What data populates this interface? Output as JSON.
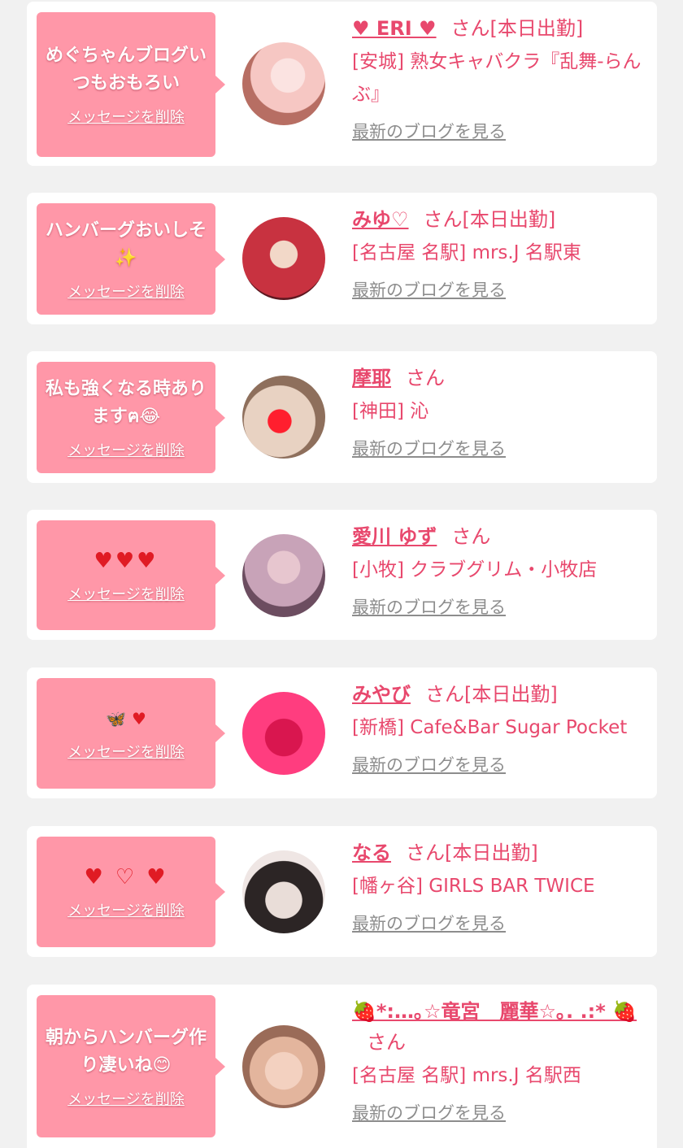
{
  "entries": [
    {
      "message": "めぐちゃんブログいつもおもろい",
      "delete_label": "メッセージを削除",
      "name": "♥ ERI ♥",
      "suffix": "さん[本日出勤]",
      "shop": "[安城] 熟女キャバクラ『乱舞-らんぶ』",
      "blog_link": "最新のブログを見る",
      "avatar_colors": [
        "#f6c7c3",
        "#b76e63"
      ]
    },
    {
      "message": "ハンバーグおいしそ✨",
      "delete_label": "メッセージを削除",
      "name": "みゆ♡",
      "suffix": "さん[本日出勤]",
      "shop": "[名古屋 名駅] mrs.J 名駅東",
      "blog_link": "最新のブログを見る",
      "avatar_colors": [
        "#c83240",
        "#e7c9b5"
      ]
    },
    {
      "message": "私も強くなる時ありますฅ😂",
      "delete_label": "メッセージを削除",
      "name": "摩耶",
      "suffix": "さん",
      "shop": "[神田] 沁",
      "blog_link": "最新のブログを見る",
      "avatar_colors": [
        "#d9c3b3",
        "#8e6f5c"
      ]
    },
    {
      "message": "♥♥♥",
      "delete_label": "メッセージを削除",
      "name": "愛川 ゆず",
      "suffix": "さん",
      "shop": "[小牧] クラブグリム・小牧店",
      "blog_link": "最新のブログを見る",
      "avatar_colors": [
        "#c8a3b8",
        "#6c4d60"
      ]
    },
    {
      "message": "🦋 ♥",
      "delete_label": "メッセージを削除",
      "name": "みやび",
      "suffix": "さん[本日出勤]",
      "shop": "[新橋] Cafe&Bar Sugar Pocket",
      "blog_link": "最新のブログを見る",
      "avatar_colors": [
        "#ff3d7f",
        "#e01c5a"
      ]
    },
    {
      "message": "♥ ♡ ♥",
      "delete_label": "メッセージを削除",
      "name": "なる",
      "suffix": "さん[本日出勤]",
      "shop": "[幡ヶ谷] GIRLS BAR TWICE",
      "blog_link": "最新のブログを見る",
      "avatar_colors": [
        "#efe6e4",
        "#2c2525"
      ]
    },
    {
      "message": "朝からハンバーグ作り凄いね😊",
      "delete_label": "メッセージを削除",
      "name": "🍓*:…｡☆竜宮　麗華☆｡. .:* 🍓",
      "suffix": "さん",
      "shop": "[名古屋 名駅] mrs.J 名駅西",
      "blog_link": "最新のブログを見る",
      "avatar_colors": [
        "#e3b59d",
        "#9a6b58"
      ]
    }
  ]
}
